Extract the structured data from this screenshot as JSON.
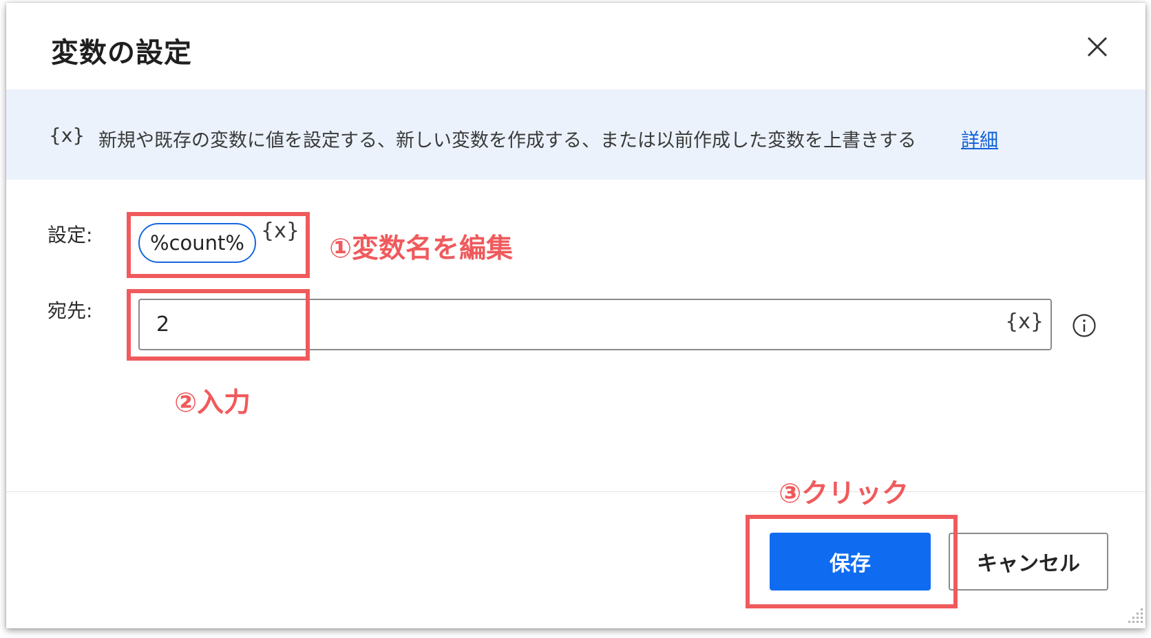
{
  "dialog": {
    "title": "変数の設定",
    "close_icon": "close-icon"
  },
  "info_bar": {
    "icon_text": "{x}",
    "description": "新規や既存の変数に値を設定する、新しい変数を作成する、または以前作成した変数を上書きする",
    "link_text": "詳細"
  },
  "form": {
    "set_label": "設定:",
    "variable_name": "%count%",
    "variable_button": "{x}",
    "to_label": "宛先:",
    "to_value": "2",
    "to_variable_button": "{x}",
    "info_icon": "info-icon"
  },
  "footer": {
    "save_label": "保存",
    "cancel_label": "キャンセル"
  },
  "annotations": {
    "step1": "①変数名を編集",
    "step2": "②入力",
    "step3": "③クリック",
    "color": "#f05a5c"
  },
  "colors": {
    "primary": "#0f6cf0",
    "info_bar_bg": "#ebf2fc",
    "link": "#0f5fd8"
  }
}
